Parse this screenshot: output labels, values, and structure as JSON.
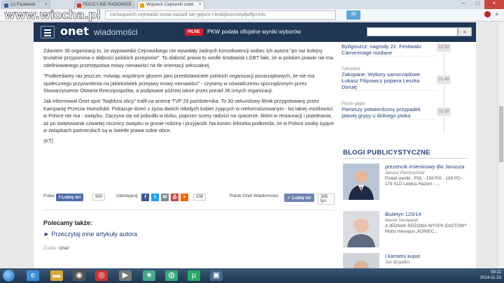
{
  "browser": {
    "tabs": [
      {
        "label": "(1) Facebook"
      },
      {
        "label": "POLICYJNE RADIOWOZ"
      },
      {
        "label": "Wojciech Cejrowski znów"
      }
    ],
    "url": "cie/wojciech-cejrowski-znow-narazil-sie-gejom-i-lesbijkom/4nyfp#fp=info",
    "extension_badge": "36",
    "site_logo": "www.wiocha.pl"
  },
  "header": {
    "logo": "onet",
    "section": "wiadomości",
    "badge": "PILNE",
    "headline": "PKW podała oficjalne wyniki wyborów",
    "search_placeholder": ""
  },
  "article": {
    "paragraphs": [
      "Zdaniem 36 organizacji to, że wypowiedzi Cejrowskiego nie wywołały żadnych konsekwencji wobec ich autora \"po raz kolejny brutalnie przypomina o słabości polskich przepisów\". Ta słabość prawa to wedle środowisk LGBT fakt, że w polskim prawie nie ma zdefiniowanego przestępstwa mowy nienawiści na tle orientacji seksualnej.",
      "\"Podkreślamy raz jeszcze, mówiąc wspólnym głosem jako przedstawiciele polskich organizacji pozarządowych, że nie ma społecznego przyzwolenia na jakiekolwiek przejawy mowy nienawiści\" - czytamy w oświadczeniu sporządzonym przez Stowarzyszenie Otwarta Rzeczpospolita, a podpisane później także przez ponad 36 innych organizacji.",
      "Jak informował Onet spot \"Najbliżsi obcy\" trafił na antenę TVP 29 października. To 30-sekundowy filmik przygotowany przez Kampanię Przeciw Homofobii. Pokazuje dzień z życia dwóch młodych kobiet żyjących w nieformalizowanym - bo takiej możliwości w Polsce nie ma - związku. Zaczyna się od pobudki w łóżku, poprzez sceny radości na spacerze, kłótni w restauracji i pojednania, aż po świętowanie czwartej rocznicy związku w gronie rodziny i przyjaciół. Na koniec lektorka podkreśla, że w Polsce osoby żyjące w związkach partnerskich są w świetle prawa sobie obce.",
      "(KT)"
    ]
  },
  "share": {
    "polec_label": "Poleć",
    "like_label": "Lubię to!",
    "like_count": "900",
    "udostepnij_label": "Udostępnij",
    "share_count": "108",
    "polub_label": "Polub Onet Wiadomości",
    "like2_label": "Lubię to!",
    "like2_count": "305 tys."
  },
  "recommended": {
    "title": "Polecamy także:",
    "link": "Przeczytaj inne artykuły autora"
  },
  "source": {
    "label": "Źródło:",
    "value": "Onet"
  },
  "feed": [
    {
      "category": "",
      "title": "Bydgoszcz: nagrody 22. Festiwalu Camerimage rozdane",
      "time": "21:52"
    },
    {
      "category": "Zakopane",
      "title": "Zakopane: Wybory samorządowe. Łukasz Filipowicz popiera Leszka Doruię",
      "time": "21:43"
    },
    {
      "category": "Ptasie grypa",
      "title": "Pierwszy potwierdzony przypadek ptasiej grypy u dzikiego ptaka",
      "time": "21:32"
    }
  ],
  "blogs": {
    "heading": "BLOGI PUBLICYSTYCZNE",
    "items": [
      {
        "title": "prezencik imieninowy dla Janusza",
        "author": "Janusz Piechociński",
        "desc": "Podali wyniki : PSL - 159 PiS - 169 PO - 179 SLD Lewica Razem - ..."
      },
      {
        "title": "Biuletyn 125/14",
        "author": "Marek Sierławski",
        "desc": "A JEDNAK RÓŻOWA WYSPA IDIOTÓW? Motto miesiąca „KONIEC..."
      },
      {
        "title": "I kamieni kupa!",
        "author": "Jan Bogatko",
        "desc": ""
      }
    ]
  },
  "taskbar": {
    "time": "00:11",
    "date": "2014-11-23"
  }
}
